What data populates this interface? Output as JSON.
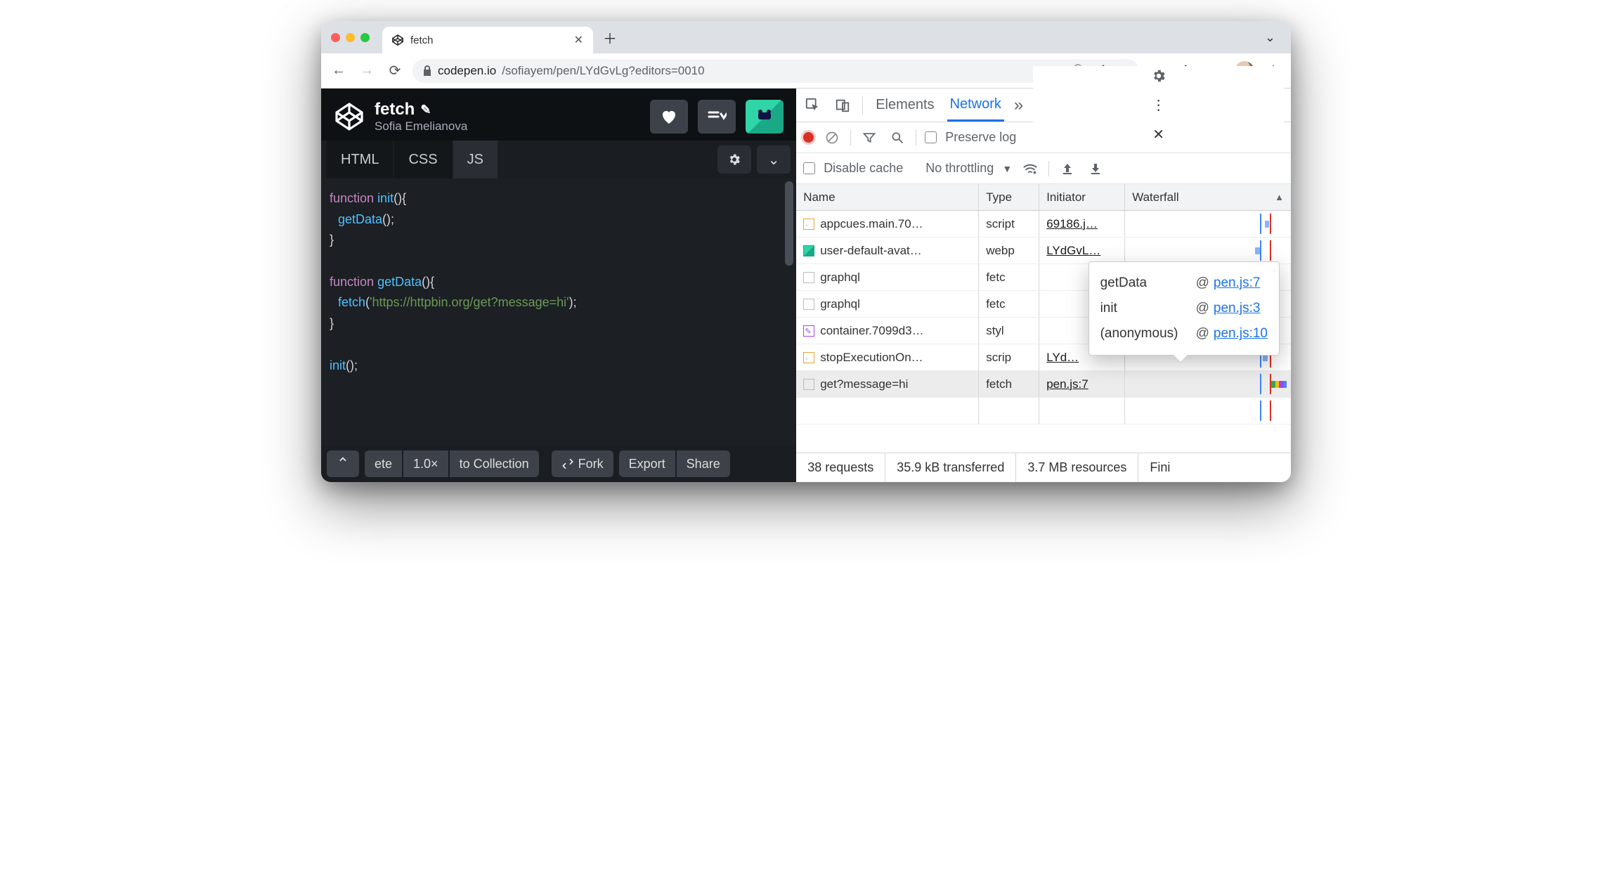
{
  "browser": {
    "tab_title": "fetch",
    "url_host": "codepen.io",
    "url_path": "/sofiayem/pen/LYdGvLg?editors=0010"
  },
  "codepen": {
    "title": "fetch",
    "author": "Sofia Emelianova",
    "tabs": {
      "html": "HTML",
      "css": "CSS",
      "js": "JS"
    },
    "footer": {
      "zoom_partial": "ete",
      "zoom": "1.0×",
      "to_collection": "to Collection",
      "fork": "Fork",
      "export": "Export",
      "share": "Share"
    },
    "code": {
      "l1_kw": "function",
      "l1_fn": "init",
      "l1_rest": "(){",
      "l2_call": "getData",
      "l2_rest": "();",
      "l3": "}",
      "l5_kw": "function",
      "l5_fn": "getData",
      "l5_rest": "(){",
      "l6_call": "fetch",
      "l6_p1": "(",
      "l6_str": "'https://httpbin.org/get?message=hi'",
      "l6_p2": ");",
      "l7": "}",
      "l9_call": "init",
      "l9_rest": "();"
    }
  },
  "devtools": {
    "tabs": {
      "elements": "Elements",
      "network": "Network"
    },
    "preserve_log": "Preserve log",
    "disable_cache": "Disable cache",
    "throttling": "No throttling",
    "columns": {
      "name": "Name",
      "type": "Type",
      "initiator": "Initiator",
      "waterfall": "Waterfall"
    },
    "rows": [
      {
        "name": "appcues.main.70…",
        "type": "script",
        "initiator": "69186.j…",
        "icon": "script"
      },
      {
        "name": "user-default-avat…",
        "type": "webp",
        "initiator": "LYdGvL…",
        "icon": "img"
      },
      {
        "name": "graphql",
        "type": "fetc",
        "initiator": "",
        "icon": "doc"
      },
      {
        "name": "graphql",
        "type": "fetc",
        "initiator": "",
        "icon": "doc"
      },
      {
        "name": "container.7099d3…",
        "type": "styl",
        "initiator": "",
        "icon": "style"
      },
      {
        "name": "stopExecutionOn…",
        "type": "scrip",
        "initiator": "LYd…",
        "icon": "script"
      },
      {
        "name": "get?message=hi",
        "type": "fetch",
        "initiator": "pen.js:7",
        "icon": "doc",
        "selected": true
      }
    ],
    "popover": [
      {
        "name": "getData",
        "loc": "pen.js:7"
      },
      {
        "name": "init",
        "loc": "pen.js:3"
      },
      {
        "name": "(anonymous)",
        "loc": "pen.js:10"
      }
    ],
    "popover_at": "@",
    "status": {
      "requests": "38 requests",
      "transferred": "35.9 kB transferred",
      "resources": "3.7 MB resources",
      "tail": "Fini"
    }
  }
}
